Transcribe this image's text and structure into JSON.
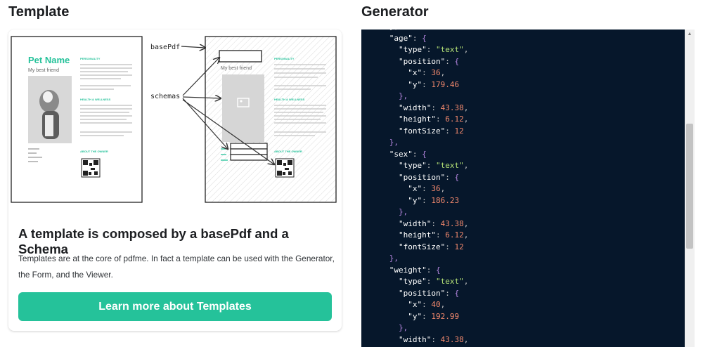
{
  "left": {
    "title": "Template",
    "illustration": {
      "left_doc": {
        "name": "Pet Name",
        "subtitle": "My best friend",
        "sections": [
          "PERSONALITY",
          "HEALTH & WELLNESS",
          "ABOUT THE OWNER"
        ]
      },
      "right_doc": {
        "subtitle": "My best friend",
        "sections": [
          "PERSONALITY",
          "HEALTH & WELLNESS",
          "ABOUT THE OWNER"
        ]
      },
      "label_basepdf": "basePdf",
      "label_schemas": "schemas"
    },
    "card": {
      "heading": "A template is composed by a basePdf and a Schema",
      "text": "Templates are at the core of pdfme. In fact a template can be used with the Generator, the Form, and the Viewer.",
      "button": "Learn more about Templates"
    },
    "colors": {
      "accent": "#25c29a"
    }
  },
  "right": {
    "title": "Generator",
    "code_lines": [
      [
        [
          "p",
          "      },"
        ]
      ],
      [
        [
          "p",
          "      "
        ],
        [
          "k",
          "\"age\""
        ],
        [
          "p",
          ": "
        ],
        [
          "b",
          "{"
        ]
      ],
      [
        [
          "p",
          "        "
        ],
        [
          "k",
          "\"type\""
        ],
        [
          "p",
          ": "
        ],
        [
          "s",
          "\"text\""
        ],
        [
          "p",
          ","
        ]
      ],
      [
        [
          "p",
          "        "
        ],
        [
          "k",
          "\"position\""
        ],
        [
          "p",
          ": "
        ],
        [
          "b",
          "{"
        ]
      ],
      [
        [
          "p",
          "          "
        ],
        [
          "k",
          "\"x\""
        ],
        [
          "p",
          ": "
        ],
        [
          "n",
          "36"
        ],
        [
          "p",
          ","
        ]
      ],
      [
        [
          "p",
          "          "
        ],
        [
          "k",
          "\"y\""
        ],
        [
          "p",
          ": "
        ],
        [
          "n",
          "179.46"
        ]
      ],
      [
        [
          "p",
          "        "
        ],
        [
          "b",
          "},"
        ]
      ],
      [
        [
          "p",
          "        "
        ],
        [
          "k",
          "\"width\""
        ],
        [
          "p",
          ": "
        ],
        [
          "n",
          "43.38"
        ],
        [
          "p",
          ","
        ]
      ],
      [
        [
          "p",
          "        "
        ],
        [
          "k",
          "\"height\""
        ],
        [
          "p",
          ": "
        ],
        [
          "n",
          "6.12"
        ],
        [
          "p",
          ","
        ]
      ],
      [
        [
          "p",
          "        "
        ],
        [
          "k",
          "\"fontSize\""
        ],
        [
          "p",
          ": "
        ],
        [
          "n",
          "12"
        ]
      ],
      [
        [
          "p",
          "      "
        ],
        [
          "b",
          "},"
        ]
      ],
      [
        [
          "p",
          "      "
        ],
        [
          "k",
          "\"sex\""
        ],
        [
          "p",
          ": "
        ],
        [
          "b",
          "{"
        ]
      ],
      [
        [
          "p",
          "        "
        ],
        [
          "k",
          "\"type\""
        ],
        [
          "p",
          ": "
        ],
        [
          "s",
          "\"text\""
        ],
        [
          "p",
          ","
        ]
      ],
      [
        [
          "p",
          "        "
        ],
        [
          "k",
          "\"position\""
        ],
        [
          "p",
          ": "
        ],
        [
          "b",
          "{"
        ]
      ],
      [
        [
          "p",
          "          "
        ],
        [
          "k",
          "\"x\""
        ],
        [
          "p",
          ": "
        ],
        [
          "n",
          "36"
        ],
        [
          "p",
          ","
        ]
      ],
      [
        [
          "p",
          "          "
        ],
        [
          "k",
          "\"y\""
        ],
        [
          "p",
          ": "
        ],
        [
          "n",
          "186.23"
        ]
      ],
      [
        [
          "p",
          "        "
        ],
        [
          "b",
          "},"
        ]
      ],
      [
        [
          "p",
          "        "
        ],
        [
          "k",
          "\"width\""
        ],
        [
          "p",
          ": "
        ],
        [
          "n",
          "43.38"
        ],
        [
          "p",
          ","
        ]
      ],
      [
        [
          "p",
          "        "
        ],
        [
          "k",
          "\"height\""
        ],
        [
          "p",
          ": "
        ],
        [
          "n",
          "6.12"
        ],
        [
          "p",
          ","
        ]
      ],
      [
        [
          "p",
          "        "
        ],
        [
          "k",
          "\"fontSize\""
        ],
        [
          "p",
          ": "
        ],
        [
          "n",
          "12"
        ]
      ],
      [
        [
          "p",
          "      "
        ],
        [
          "b",
          "},"
        ]
      ],
      [
        [
          "p",
          "      "
        ],
        [
          "k",
          "\"weight\""
        ],
        [
          "p",
          ": "
        ],
        [
          "b",
          "{"
        ]
      ],
      [
        [
          "p",
          "        "
        ],
        [
          "k",
          "\"type\""
        ],
        [
          "p",
          ": "
        ],
        [
          "s",
          "\"text\""
        ],
        [
          "p",
          ","
        ]
      ],
      [
        [
          "p",
          "        "
        ],
        [
          "k",
          "\"position\""
        ],
        [
          "p",
          ": "
        ],
        [
          "b",
          "{"
        ]
      ],
      [
        [
          "p",
          "          "
        ],
        [
          "k",
          "\"x\""
        ],
        [
          "p",
          ": "
        ],
        [
          "n",
          "40"
        ],
        [
          "p",
          ","
        ]
      ],
      [
        [
          "p",
          "          "
        ],
        [
          "k",
          "\"y\""
        ],
        [
          "p",
          ": "
        ],
        [
          "n",
          "192.99"
        ]
      ],
      [
        [
          "p",
          "        "
        ],
        [
          "b",
          "},"
        ]
      ],
      [
        [
          "p",
          "        "
        ],
        [
          "k",
          "\"width\""
        ],
        [
          "p",
          ": "
        ],
        [
          "n",
          "43.38"
        ],
        [
          "p",
          ","
        ]
      ]
    ],
    "colors": {
      "background": "#06172b",
      "string": "#b4e176",
      "number": "#f3896d",
      "brace": "#b687e0"
    }
  }
}
